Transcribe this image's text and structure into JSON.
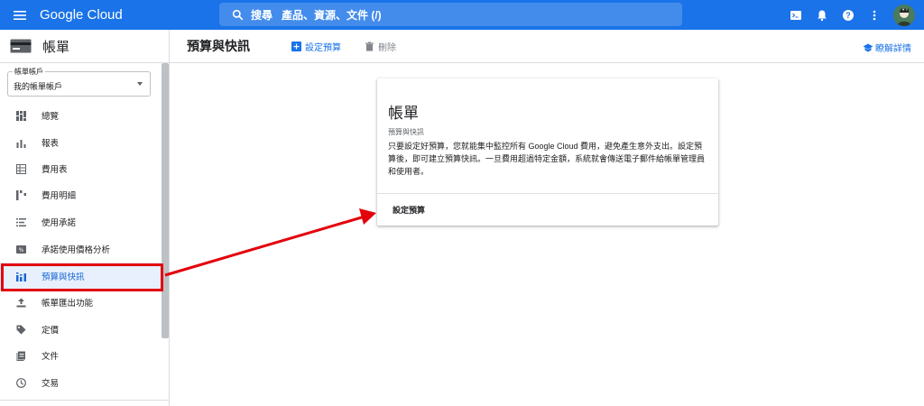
{
  "topbar": {
    "logo": "Google Cloud",
    "search_label": "搜尋",
    "search_placeholder": "產品、資源、文件 (/)"
  },
  "sidenav": {
    "title": "帳單",
    "account_label": "帳單帳戶",
    "account_value": "我的帳單帳戶",
    "items": [
      {
        "label": "總覽",
        "icon": "overview-icon"
      },
      {
        "label": "報表",
        "icon": "reports-icon"
      },
      {
        "label": "費用表",
        "icon": "cost-table-icon"
      },
      {
        "label": "費用明細",
        "icon": "cost-breakdown-icon"
      },
      {
        "label": "使用承諾",
        "icon": "commitments-icon"
      },
      {
        "label": "承諾使用價格分析",
        "icon": "commitment-analysis-icon"
      },
      {
        "label": "預算與快訊",
        "icon": "budgets-icon",
        "active": true
      },
      {
        "label": "帳單匯出功能",
        "icon": "export-icon"
      },
      {
        "label": "定價",
        "icon": "pricing-tag-icon"
      },
      {
        "label": "文件",
        "icon": "documents-icon"
      },
      {
        "label": "交易",
        "icon": "transactions-icon"
      }
    ]
  },
  "page": {
    "title": "預算與快訊",
    "create_budget": "設定預算",
    "delete": "刪除",
    "learn_more": "瞭解詳情"
  },
  "card": {
    "title": "帳單",
    "subtitle": "預算與快訊",
    "body": "只要設定好預算，您就能集中監控所有 Google Cloud 費用，避免產生意外支出。設定預算後，即可建立預算快訊。一旦費用超過特定金額，系統就會傳送電子郵件給帳單管理員和使用者。",
    "button": "設定預算"
  },
  "colors": {
    "brand": "#1a73e8",
    "annotation": "#e3000b",
    "active_bg": "#e8f0fe"
  }
}
